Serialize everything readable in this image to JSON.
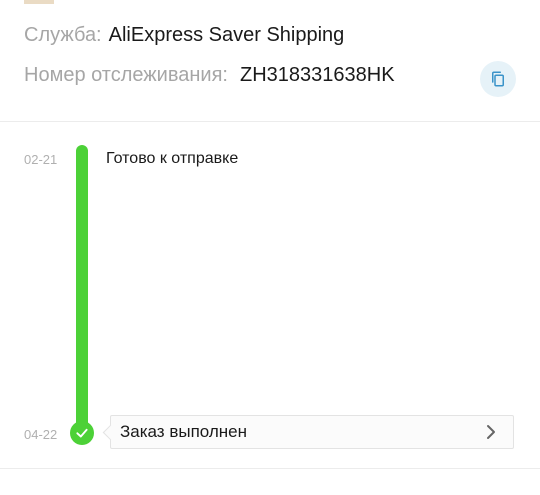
{
  "shipment": {
    "service_label": "Служба:",
    "service_value": "AliExpress Saver Shipping",
    "tracking_label": "Номер отслеживания:",
    "tracking_value": "ZH318331638HK",
    "copy_icon": "copy-icon"
  },
  "timeline": {
    "events": [
      {
        "date": "02-21",
        "text": "Готово к отправке"
      },
      {
        "date": "04-22",
        "text": "Заказ выполнен"
      }
    ],
    "progress_color": "#4cd137",
    "status_icon": "check-icon",
    "detail_icon": "chevron-right-icon"
  }
}
